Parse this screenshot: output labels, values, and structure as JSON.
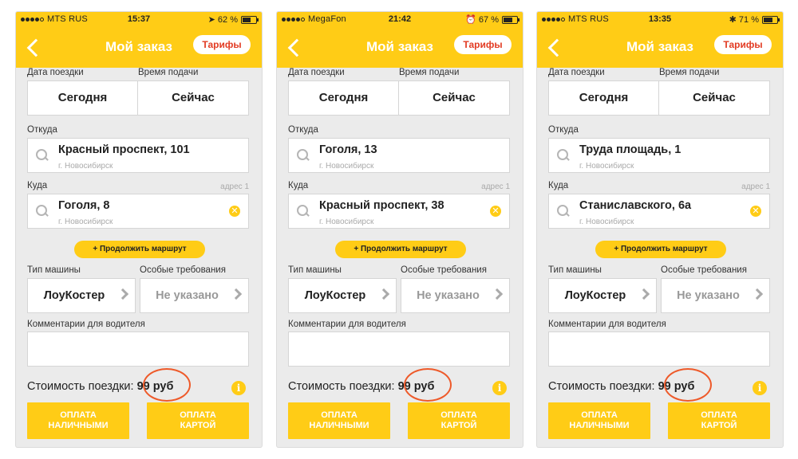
{
  "screens": [
    {
      "status": {
        "carrier": "MTS RUS",
        "time": "15:37",
        "right": "➤  62 %",
        "battery": 0.62
      },
      "nav": {
        "title": "Мой заказ",
        "tariffs": "Тарифы"
      },
      "date_label": "Дата поездки",
      "time_label": "Время подачи",
      "date_value": "Сегодня",
      "time_value": "Сейчас",
      "from_label": "Откуда",
      "from_address": "Красный проспект, 101",
      "from_city": "г. Новосибирск",
      "to_label": "Куда",
      "to_hint": "адрес 1",
      "to_address": "Гоголя, 8",
      "to_city": "г. Новосибирск",
      "continue_route": "+ Продолжить маршрут",
      "car_type_label": "Тип машины",
      "car_type_value": "ЛоуКостер",
      "requirements_label": "Особые требования",
      "requirements_value": "Не указано",
      "comment_label": "Комментарии для водителя",
      "cost_label": "Стоимость поездки:",
      "cost_value": "99 руб",
      "cash_button": [
        "ОПЛАТА",
        "НАЛИЧНЫМИ"
      ],
      "card_button": [
        "ОПЛАТА",
        "КАРТОЙ"
      ]
    },
    {
      "status": {
        "carrier": "MegaFon",
        "time": "21:42",
        "right": "⏰  67 %",
        "battery": 0.67
      },
      "nav": {
        "title": "Мой заказ",
        "tariffs": "Тарифы"
      },
      "date_label": "Дата поездки",
      "time_label": "Время подачи",
      "date_value": "Сегодня",
      "time_value": "Сейчас",
      "from_label": "Откуда",
      "from_address": "Гоголя, 13",
      "from_city": "г. Новосибирск",
      "to_label": "Куда",
      "to_hint": "адрес 1",
      "to_address": "Красный проспект, 38",
      "to_city": "г. Новосибирск",
      "continue_route": "+ Продолжить маршрут",
      "car_type_label": "Тип машины",
      "car_type_value": "ЛоуКостер",
      "requirements_label": "Особые требования",
      "requirements_value": "Не указано",
      "comment_label": "Комментарии для водителя",
      "cost_label": "Стоимость поездки:",
      "cost_value": "99 руб",
      "cash_button": [
        "ОПЛАТА",
        "НАЛИЧНЫМИ"
      ],
      "card_button": [
        "ОПЛАТА",
        "КАРТОЙ"
      ]
    },
    {
      "status": {
        "carrier": "MTS RUS",
        "time": "13:35",
        "right": "✱  71 %",
        "battery": 0.71
      },
      "nav": {
        "title": "Мой заказ",
        "tariffs": "Тарифы"
      },
      "date_label": "Дата поездки",
      "time_label": "Время подачи",
      "date_value": "Сегодня",
      "time_value": "Сейчас",
      "from_label": "Откуда",
      "from_address": "Труда площадь, 1",
      "from_city": "г. Новосибирск",
      "to_label": "Куда",
      "to_hint": "адрес 1",
      "to_address": "Станиславского, 6а",
      "to_city": "г. Новосибирск",
      "continue_route": "+ Продолжить маршрут",
      "car_type_label": "Тип машины",
      "car_type_value": "ЛоуКостер",
      "requirements_label": "Особые требования",
      "requirements_value": "Не указано",
      "comment_label": "Комментарии для водителя",
      "cost_label": "Стоимость поездки:",
      "cost_value": "99 руб",
      "cash_button": [
        "ОПЛАТА",
        "НАЛИЧНЫМИ"
      ],
      "card_button": [
        "ОПЛАТА",
        "КАРТОЙ"
      ]
    }
  ],
  "colors": {
    "accent": "#ffcc16",
    "highlight_ring": "#ee5a2a",
    "tariffs_text": "#e23b23"
  },
  "icons": [
    "back-chevron-icon",
    "search-icon",
    "clear-icon",
    "chevron-right-icon",
    "info-icon"
  ]
}
